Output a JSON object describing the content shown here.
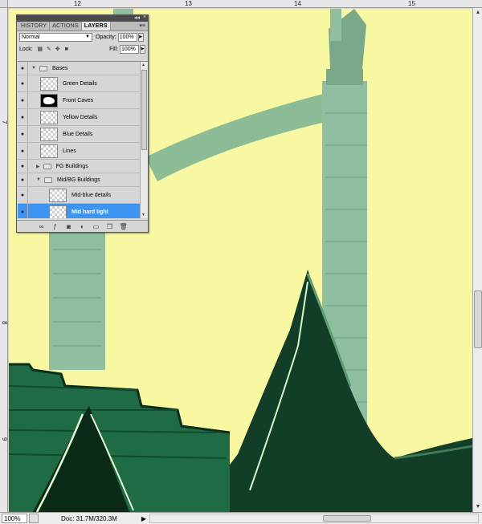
{
  "rulers": {
    "top_marks": [
      "12",
      "13",
      "14",
      "15"
    ],
    "left_marks": [
      "7",
      "8",
      "9"
    ]
  },
  "layers_panel": {
    "tabs": [
      "HISTORY",
      "ACTIONS",
      "LAYERS"
    ],
    "active_tab": "LAYERS",
    "blend_mode": "Normal",
    "opacity_label": "Opacity:",
    "opacity_value": "100%",
    "lock_label": "Lock:",
    "fill_label": "Fill:",
    "fill_value": "100%",
    "layers": [
      {
        "name": "Bases",
        "kind": "group",
        "expanded": true
      },
      {
        "name": "Green Details",
        "kind": "layer"
      },
      {
        "name": "Front Caves",
        "kind": "layer",
        "thumb": "mask"
      },
      {
        "name": "Yellow Details",
        "kind": "layer"
      },
      {
        "name": "Blue Details",
        "kind": "layer"
      },
      {
        "name": "Lines",
        "kind": "layer"
      },
      {
        "name": "FG Buildings",
        "kind": "group",
        "expanded": false
      },
      {
        "name": "Mid/BG Buildings",
        "kind": "group",
        "expanded": true
      },
      {
        "name": "Mid-blue details",
        "kind": "layer"
      },
      {
        "name": "Mid hard light",
        "kind": "layer",
        "selected": true
      }
    ],
    "bottom_icons": [
      "link-icon",
      "fx-icon",
      "mask-icon",
      "adjustment-icon",
      "folder-icon",
      "new-layer-icon",
      "trash-icon"
    ]
  },
  "status_bar": {
    "zoom": "100%",
    "doc_info": "Doc: 31.7M/320.3M"
  },
  "colors": {
    "canvas_bg": "#f8f7a2",
    "selection": "#3d95f1",
    "tower": "#8fbfa0",
    "dark_green": "#0e3b22"
  }
}
